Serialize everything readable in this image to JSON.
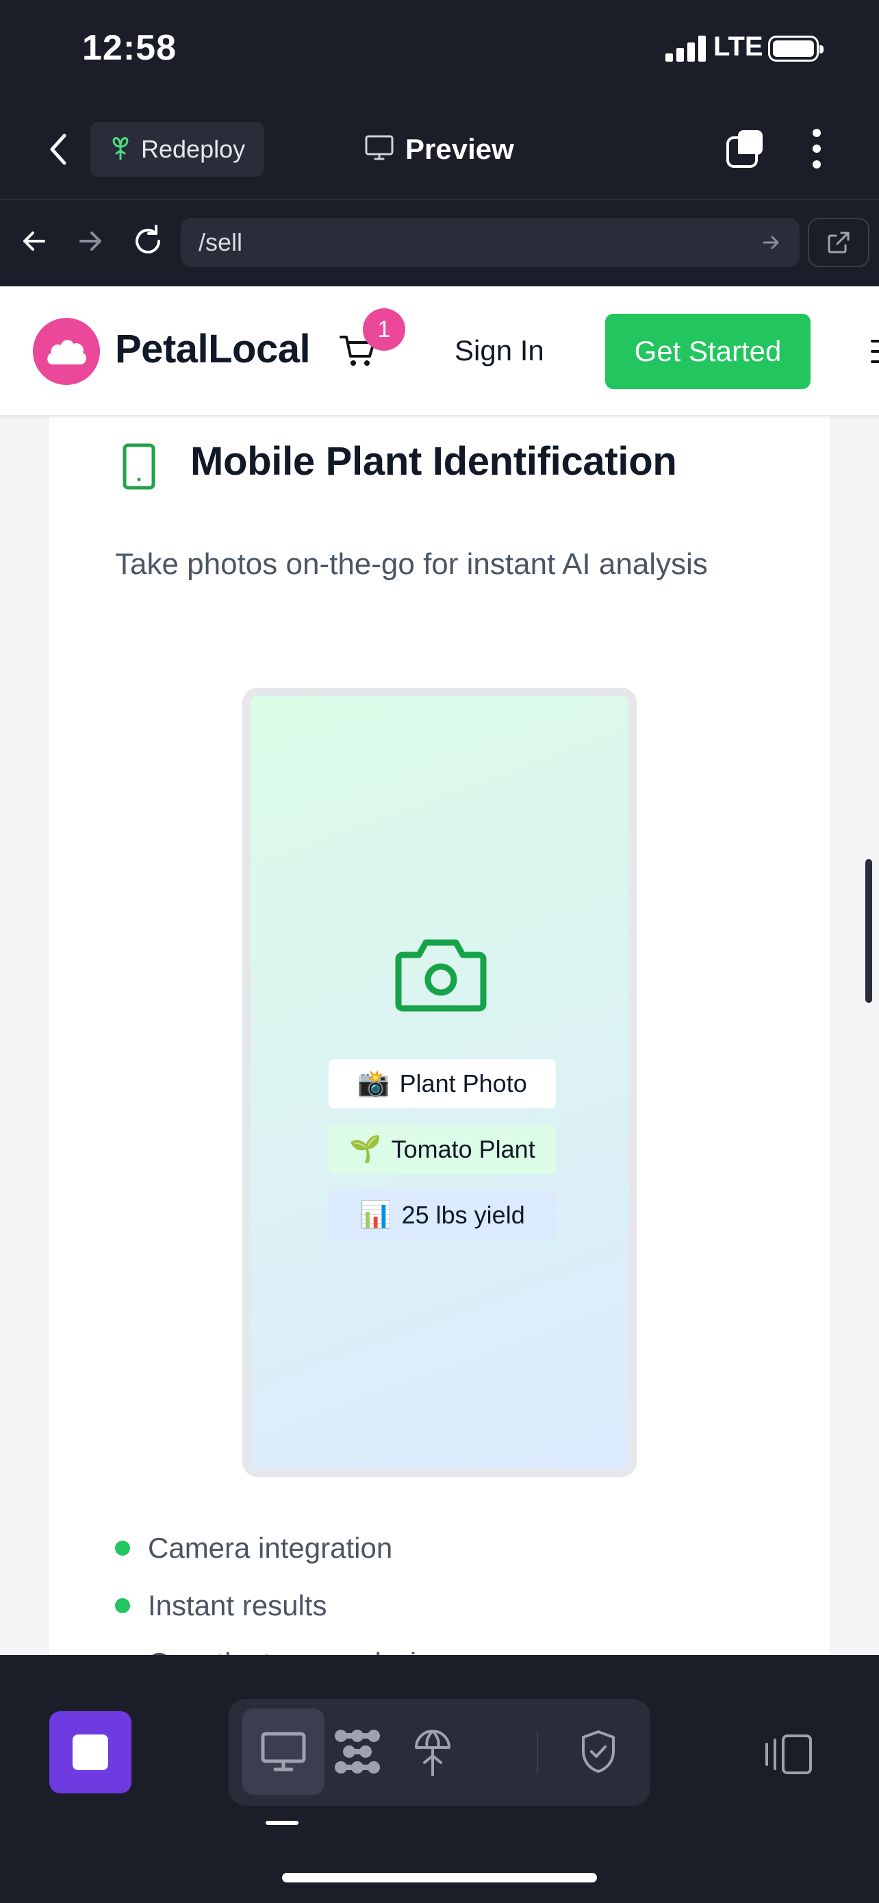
{
  "status_bar": {
    "time": "12:58",
    "network": "LTE"
  },
  "app_bar": {
    "redeploy_label": "Redeploy",
    "preview_label": "Preview"
  },
  "browser": {
    "url": "/sell"
  },
  "site": {
    "brand": "PetalLocal",
    "cart_count": "1",
    "sign_in": "Sign In",
    "get_started": "Get Started"
  },
  "feature_card": {
    "title": "Mobile Plant Identification",
    "description": "Take photos on-the-go for instant AI analysis",
    "chips": [
      {
        "emoji": "📸",
        "label": "Plant Photo"
      },
      {
        "emoji": "🌱",
        "label": "Tomato Plant"
      },
      {
        "emoji": "📊",
        "label": "25 lbs yield"
      }
    ],
    "features": [
      "Camera integration",
      "Instant results",
      "Growth stage analysis"
    ]
  },
  "colors": {
    "brand_pink": "#ec4899",
    "brand_green": "#22c55e",
    "toolbar_bg": "#1b1d29",
    "stop_purple": "#6d3be0"
  },
  "icons": [
    "back-icon",
    "plant-icon",
    "monitor-icon",
    "tabs-icon",
    "more-icon",
    "arrow-left-icon",
    "arrow-right-icon",
    "reload-icon",
    "go-icon",
    "external-link-icon",
    "cart-icon",
    "menu-icon",
    "phone-icon",
    "camera-icon",
    "stop-icon",
    "desktop-icon",
    "apps-icon",
    "deploy-icon",
    "shield-icon",
    "rotate-icon"
  ]
}
